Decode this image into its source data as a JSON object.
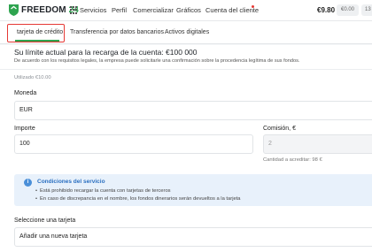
{
  "header": {
    "brand_word": "FREEDOM",
    "brand_num": "24",
    "nav": [
      "Servicios",
      "Perfil",
      "Comercializar",
      "Gráficos",
      "Cuenta del cliente"
    ],
    "balance": "€9.80",
    "balance_pill": "€0.00",
    "extra_pill": "13"
  },
  "tabs": [
    "tarjeta de crédito",
    "Transferencia por datos bancarios",
    "Activos digitales"
  ],
  "limit": {
    "title": "Su límite actual para la recarga de la cuenta: €100 000",
    "note": "De acuerdo con los requisitos legales, la empresa puede solicitarle una confirmación sobre la procedencia legítima de sus fondos.",
    "used": "Utilizado €10.00"
  },
  "form": {
    "currency_label": "Moneda",
    "currency_value": "EUR",
    "amount_label": "Importe",
    "amount_value": "100",
    "commission_label": "Comisión, €",
    "commission_value": "2",
    "credited_hint": "Cantidad a acreditar: 98 €",
    "card_label": "Seleccione una tarjeta",
    "card_value": "Añadir una nueva tarjeta"
  },
  "conditions": {
    "title": "Condiciones del servicio",
    "items": [
      "Está prohibido recargar la cuenta con tarjetas de terceros",
      "En caso de discrepancia en el nombre, los fondos dinerarios serán devueltos a la tarjeta"
    ]
  },
  "colors": {
    "brand_green": "#2ea44f",
    "highlight_red": "#e53935",
    "info_blue": "#2a6fc0"
  }
}
